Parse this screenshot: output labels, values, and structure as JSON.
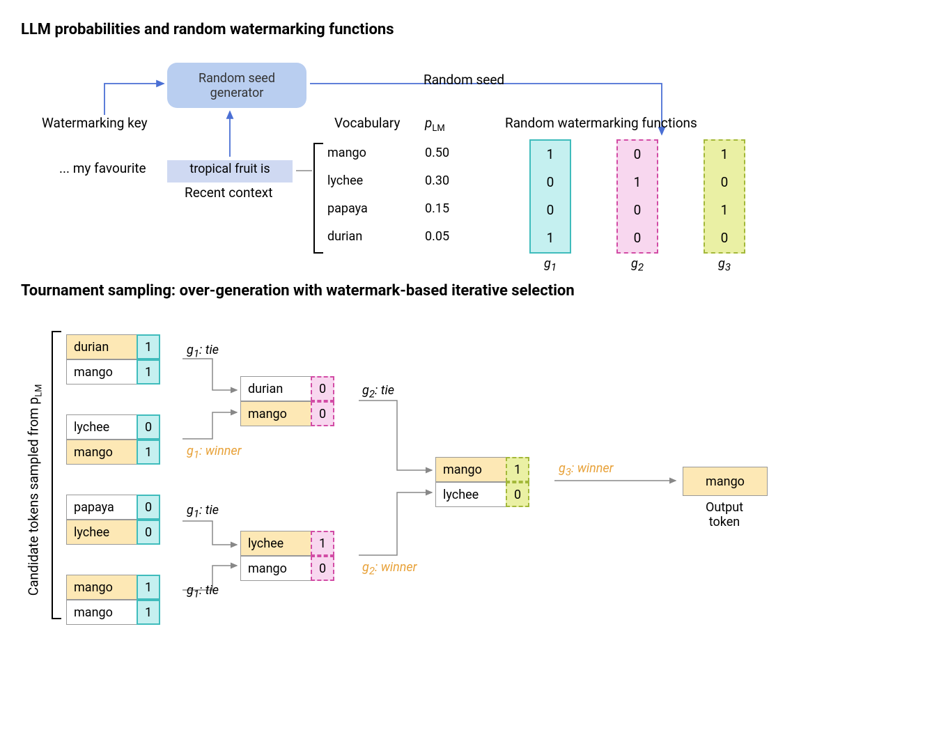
{
  "titles": {
    "section1": "LLM probabilities and random watermarking functions",
    "section2": "Tournament sampling: over-generation with watermark-based iterative selection"
  },
  "labels": {
    "watermarking_key": "Watermarking key",
    "seed_gen_l1": "Random seed",
    "seed_gen_l2": "generator",
    "random_seed": "Random seed",
    "vocab": "Vocabulary",
    "plm": "p",
    "plm_sub": "LM",
    "rwf": "Random watermarking functions",
    "prefix": "... my favourite",
    "context": "tropical fruit is",
    "recent_context": "Recent context",
    "candidates": "Candidate tokens sampled from p",
    "candidates_sub": "LM",
    "output_token": "Output token",
    "g": [
      "g",
      "g",
      "g"
    ],
    "g_sub": [
      "1",
      "2",
      "3"
    ]
  },
  "vocab": [
    "mango",
    "lychee",
    "papaya",
    "durian"
  ],
  "plm_vals": [
    "0.50",
    "0.30",
    "0.15",
    "0.05"
  ],
  "gvals": {
    "g1": [
      "1",
      "0",
      "0",
      "1"
    ],
    "g2": [
      "0",
      "1",
      "0",
      "0"
    ],
    "g3": [
      "1",
      "0",
      "1",
      "0"
    ]
  },
  "tournament": {
    "col1": [
      {
        "name": "durian",
        "bit": "1",
        "win": true
      },
      {
        "name": "mango",
        "bit": "1",
        "win": false
      },
      {
        "name": "lychee",
        "bit": "0",
        "win": false
      },
      {
        "name": "mango",
        "bit": "1",
        "win": true
      },
      {
        "name": "papaya",
        "bit": "0",
        "win": false
      },
      {
        "name": "lychee",
        "bit": "0",
        "win": true
      },
      {
        "name": "mango",
        "bit": "1",
        "win": true
      },
      {
        "name": "mango",
        "bit": "1",
        "win": false
      }
    ],
    "c1notes": [
      {
        "g": "g",
        "s": "1",
        "txt": ": tie",
        "win": false
      },
      {
        "g": "g",
        "s": "1",
        "txt": ": winner",
        "win": true
      },
      {
        "g": "g",
        "s": "1",
        "txt": ": tie",
        "win": false
      },
      {
        "g": "g",
        "s": "1",
        "txt": ": tie",
        "win": false
      }
    ],
    "col2": [
      {
        "name": "durian",
        "bit": "0",
        "win": false
      },
      {
        "name": "mango",
        "bit": "0",
        "win": true
      },
      {
        "name": "lychee",
        "bit": "1",
        "win": true
      },
      {
        "name": "mango",
        "bit": "0",
        "win": false
      }
    ],
    "c2notes": [
      {
        "g": "g",
        "s": "2",
        "txt": ": tie",
        "win": false
      },
      {
        "g": "g",
        "s": "2",
        "txt": ": winner",
        "win": true
      }
    ],
    "col3": [
      {
        "name": "mango",
        "bit": "1",
        "win": true
      },
      {
        "name": "lychee",
        "bit": "0",
        "win": false
      }
    ],
    "c3note": {
      "g": "g",
      "s": "3",
      "txt": ": winner",
      "win": true
    },
    "output": "mango"
  }
}
